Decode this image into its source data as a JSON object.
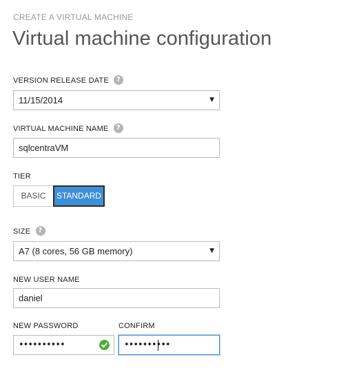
{
  "header": {
    "eyebrow": "CREATE A VIRTUAL MACHINE",
    "title": "Virtual machine configuration"
  },
  "form": {
    "version_release_date": {
      "label": "VERSION RELEASE DATE",
      "value": "11/15/2014"
    },
    "vm_name": {
      "label": "VIRTUAL MACHINE NAME",
      "value": "sqlcentraVM"
    },
    "tier": {
      "label": "TIER",
      "options": [
        "BASIC",
        "STANDARD"
      ],
      "selected": "STANDARD"
    },
    "size": {
      "label": "SIZE",
      "value": "A7 (8 cores, 56 GB memory)"
    },
    "user_name": {
      "label": "NEW USER NAME",
      "value": "daniel"
    },
    "password": {
      "label": "NEW PASSWORD",
      "masked_value": "••••••••••",
      "valid": true
    },
    "confirm": {
      "label": "CONFIRM",
      "masked_value": "••••••••••"
    }
  },
  "icons": {
    "help": "?",
    "dropdown": "▼",
    "valid": "check-circle-icon"
  },
  "colors": {
    "accent": "#3f8fd8",
    "valid_green": "#4cae3c",
    "help_gray": "#b5b5b5"
  }
}
